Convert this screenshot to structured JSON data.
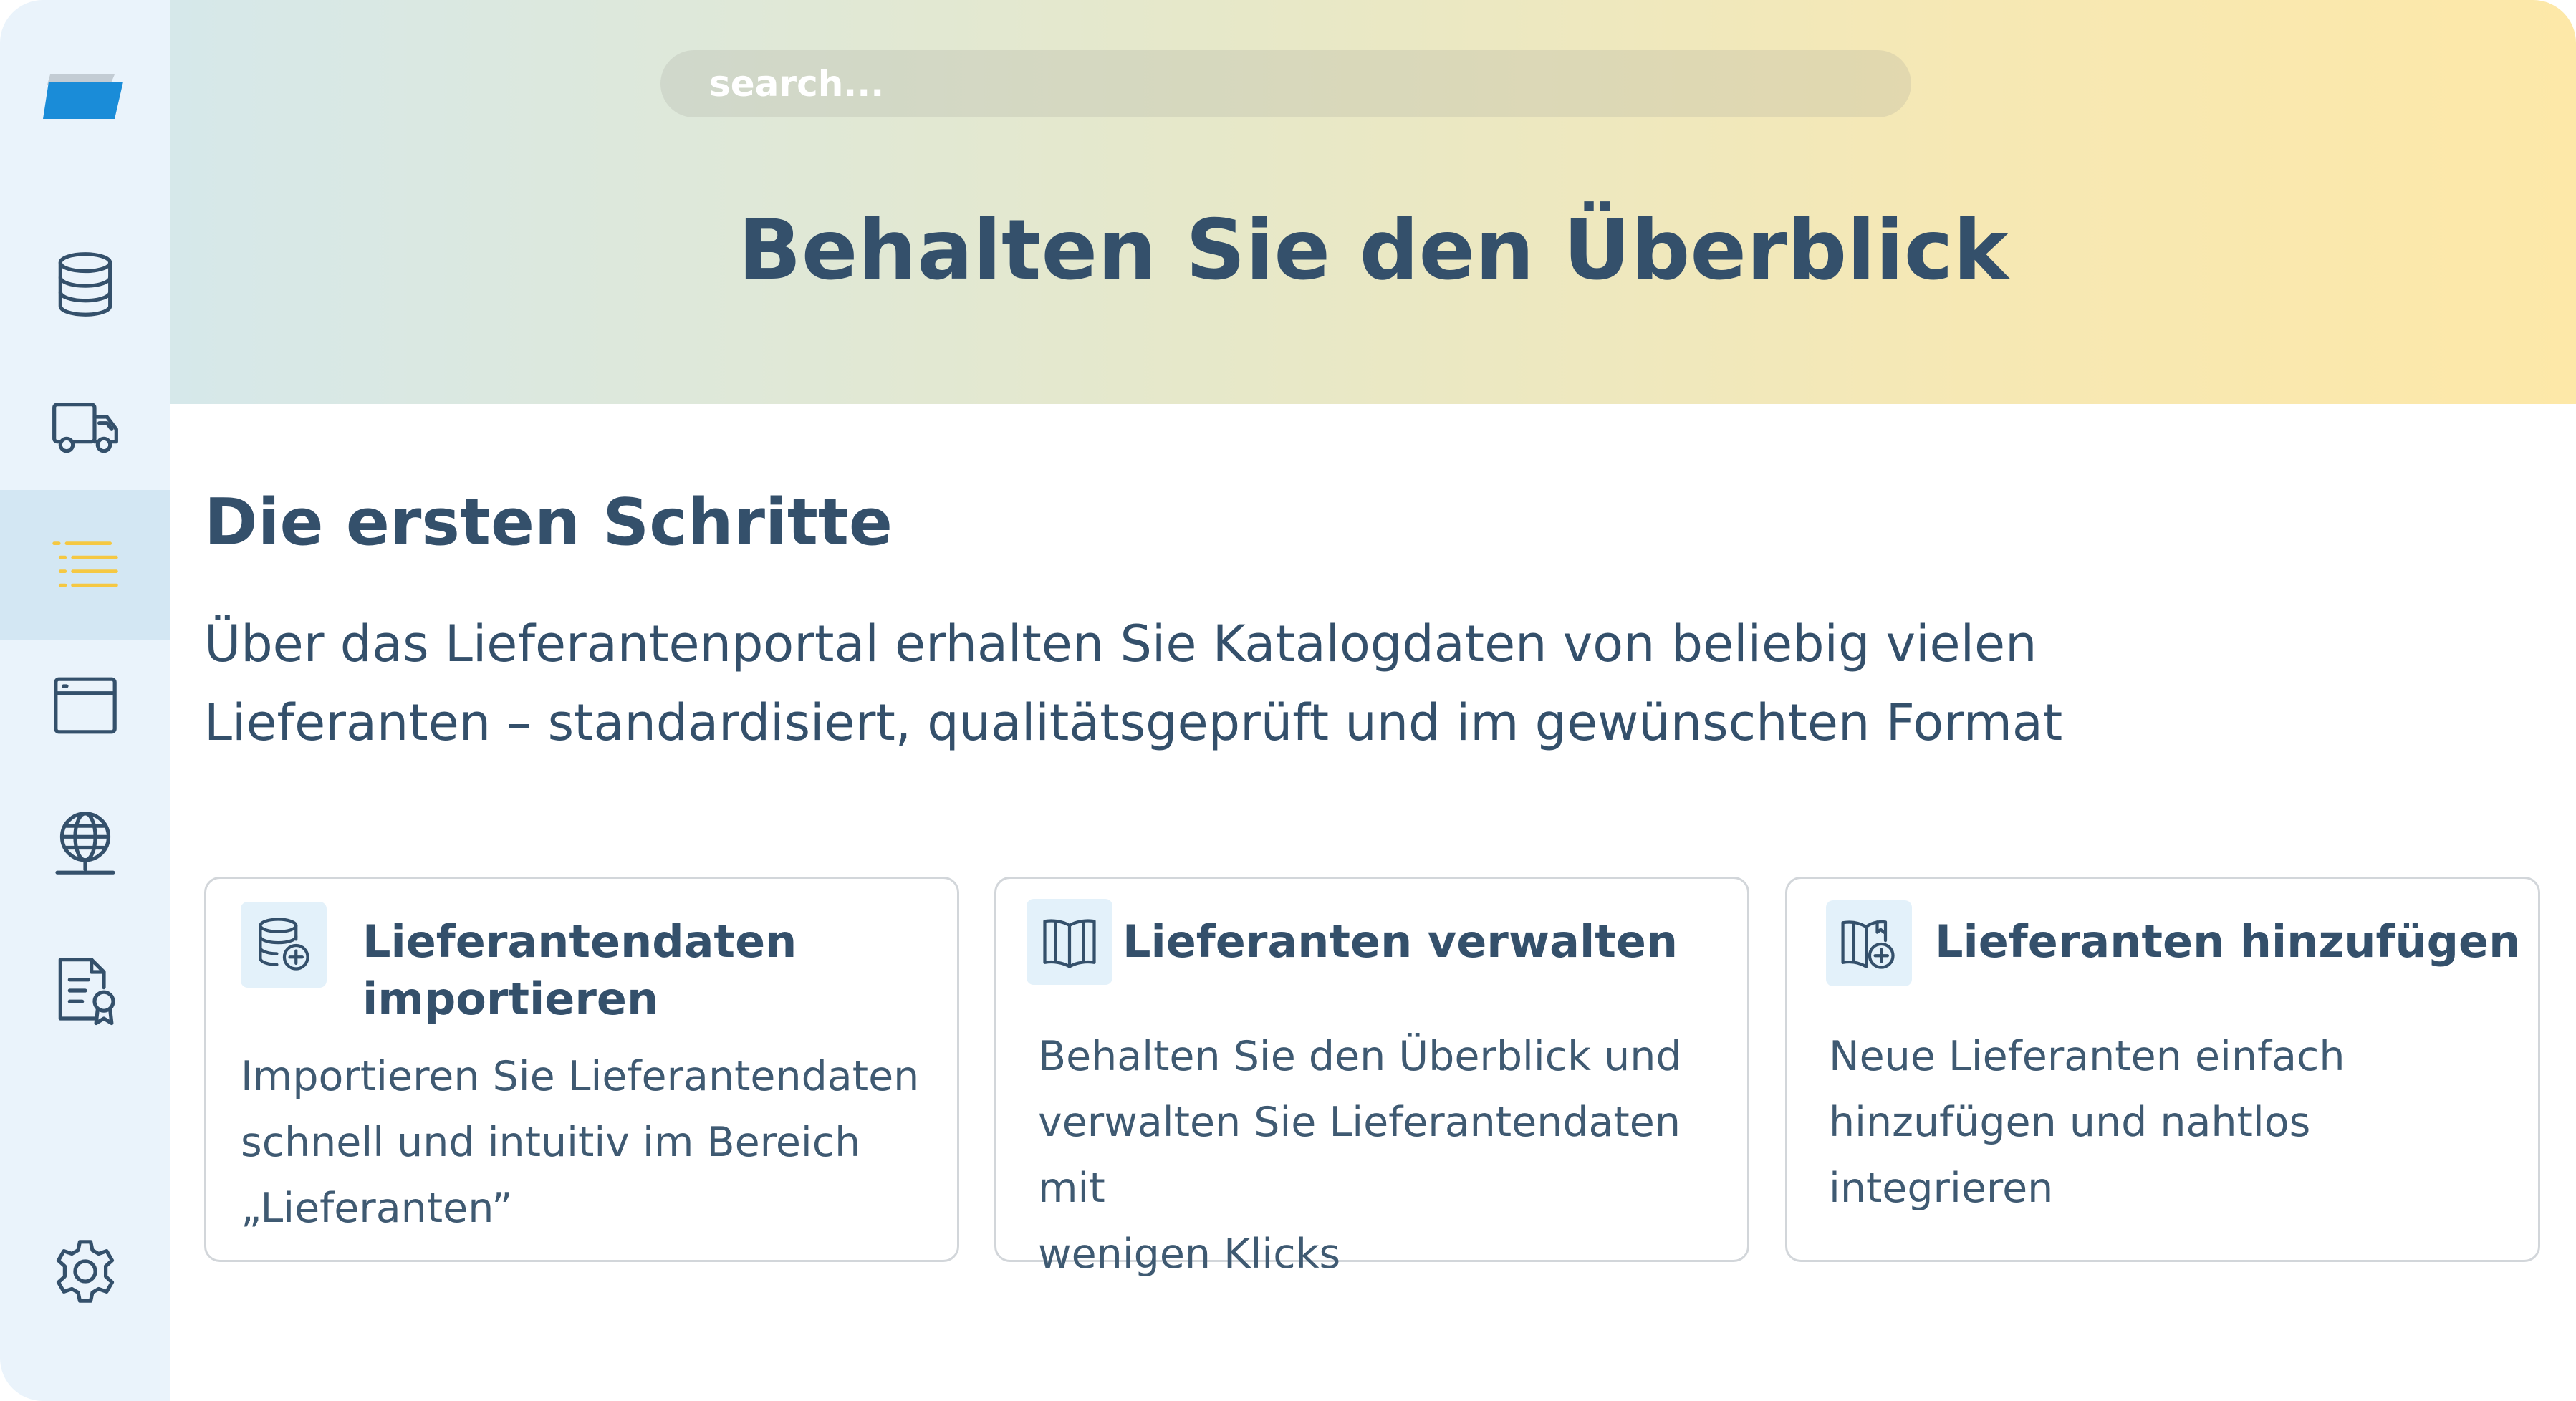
{
  "sidebar": {
    "logo_icon": "app-logo-icon",
    "items": [
      {
        "icon": "database-icon",
        "active": false
      },
      {
        "icon": "truck-icon",
        "active": false
      },
      {
        "icon": "list-icon",
        "active": true
      },
      {
        "icon": "browser-window-icon",
        "active": false
      },
      {
        "icon": "globe-icon",
        "active": false
      },
      {
        "icon": "certificate-document-icon",
        "active": false
      }
    ],
    "settings_icon": "gear-icon"
  },
  "header": {
    "search_placeholder": "search...",
    "title": "Behalten Sie den Überblick"
  },
  "main": {
    "section_title": "Die ersten Schritte",
    "intro_line1": "Über das Lieferantenportal erhalten Sie Katalogdaten von beliebig vielen",
    "intro_line2": "Lieferanten – standardisiert, qualitätsgeprüft und im gewünschten Format",
    "cards": [
      {
        "icon": "database-add-icon",
        "title_line1": "Lieferantendaten",
        "title_line2": "importieren",
        "desc_line1": "Importieren Sie Lieferantendaten",
        "desc_line2": "schnell und intuitiv im Bereich",
        "desc_line3": "„Lieferanten”"
      },
      {
        "icon": "book-open-icon",
        "title_line1": "Lieferanten verwalten",
        "desc_line1": "Behalten Sie den Überblick und",
        "desc_line2": "verwalten Sie Lieferantendaten mit",
        "desc_line3": "wenigen Klicks"
      },
      {
        "icon": "book-add-icon",
        "title_line1": "Lieferanten hinzufügen",
        "desc_line1": "Neue Lieferanten einfach",
        "desc_line2": "hinzufügen und nahtlos integrieren"
      }
    ]
  },
  "colors": {
    "text": "#34506b",
    "sidebar_bg": "#eaf3fb",
    "sidebar_active_bg": "#d3e7f3",
    "accent_yellow": "#f5c842",
    "logo_blue": "#1a8cd8",
    "card_border": "#d2d6da"
  }
}
